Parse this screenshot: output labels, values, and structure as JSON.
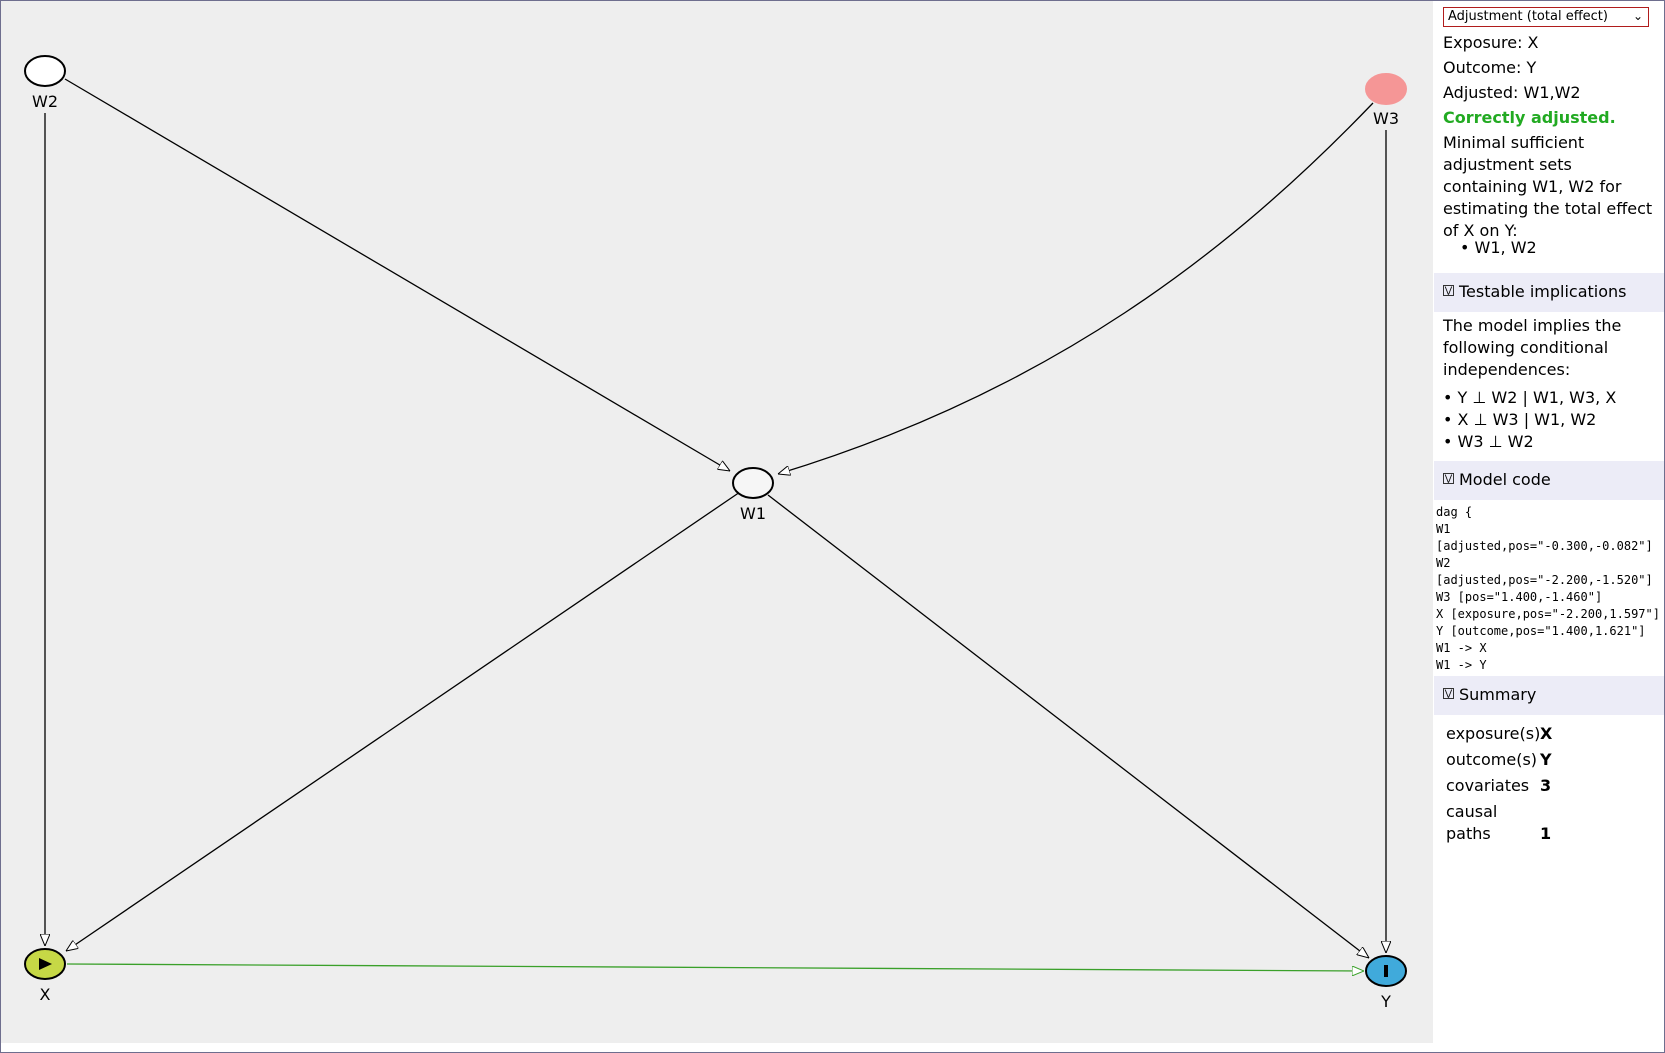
{
  "panel": {
    "mode_select": "Adjustment (total effect)",
    "exposure_line": "Exposure: X",
    "outcome_line": "Outcome: Y",
    "adjusted_line": "Adjusted: W1,W2",
    "status": "Correctly adjusted.",
    "status_color": "#22aa22",
    "min_sets_text": "Minimal sufficient adjustment sets containing W1, W2 for estimating the total effect of X on Y:",
    "min_sets": [
      "W1, W2"
    ]
  },
  "testable": {
    "title": "Testable implications",
    "intro": "The model implies the following conditional independences:",
    "items": [
      "Y ⊥ W2 | W1, W3, X",
      "X ⊥ W3 | W1, W2",
      "W3 ⊥ W2"
    ]
  },
  "model_code": {
    "title": "Model code",
    "lines": [
      "dag {",
      "W1",
      "[adjusted,pos=\"-0.300,-0.082\"]",
      "W2",
      "[adjusted,pos=\"-2.200,-1.520\"]",
      "W3 [pos=\"1.400,-1.460\"]",
      "X [exposure,pos=\"-2.200,1.597\"]",
      "Y [outcome,pos=\"1.400,1.621\"]",
      "W1 -> X",
      "W1 -> Y"
    ]
  },
  "summary": {
    "title": "Summary",
    "rows": [
      {
        "key": "exposure(s)",
        "value": "X"
      },
      {
        "key": "outcome(s)",
        "value": "Y"
      },
      {
        "key": "covariates",
        "value": "3"
      },
      {
        "key": "causal paths",
        "value": "1"
      }
    ]
  },
  "graph": {
    "nodes": {
      "W1": {
        "label": "W1",
        "kind": "adjusted",
        "fill": "#f6f6f6"
      },
      "W2": {
        "label": "W2",
        "kind": "adjusted",
        "fill": "#ffffff"
      },
      "W3": {
        "label": "W3",
        "kind": "other",
        "fill": "#f59696"
      },
      "X": {
        "label": "X",
        "kind": "exposure",
        "fill": "#c6d846"
      },
      "Y": {
        "label": "Y",
        "kind": "outcome",
        "fill": "#40aadb"
      }
    },
    "edge_colors": {
      "normal": "#000000",
      "causal": "#3aa02a"
    },
    "background": "#eeeeee"
  }
}
